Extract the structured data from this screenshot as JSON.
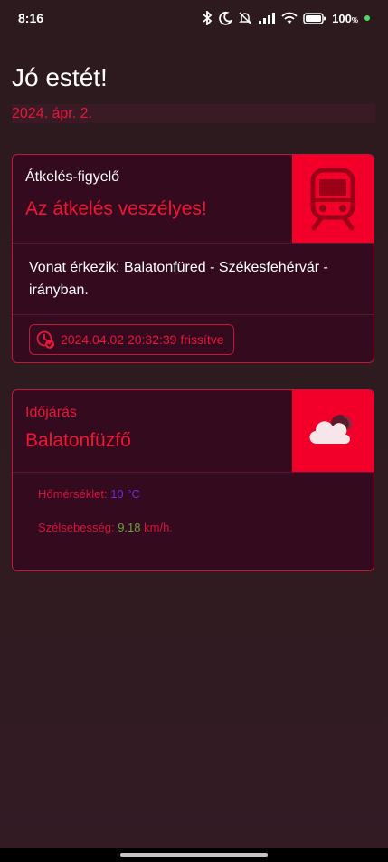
{
  "status_bar": {
    "time": "8:16",
    "battery": "100",
    "icons": [
      "bluetooth-icon",
      "moon-icon",
      "bell-muted-icon",
      "signal-icon",
      "wifi-icon",
      "battery-icon"
    ]
  },
  "header": {
    "greeting": "Jó estét!",
    "date": "2024. ápr. 2."
  },
  "crossing_card": {
    "subtitle": "Átkelés-figyelő",
    "status": "Az átkelés veszélyes!",
    "message": "Vonat érkezik: Balatonfüred - Székesfehérvár - irányban.",
    "updated": "2024.04.02 20:32:39 frissítve",
    "icon": "train-icon"
  },
  "weather_card": {
    "subtitle": "Időjárás",
    "location": "Balatonfüzfő",
    "icon": "cloudy-night-icon",
    "temperature_label": "Hőmérséklet:",
    "temperature_value": "10 °C",
    "wind_label": "Szélsebesség:",
    "wind_value": "9.18",
    "wind_unit": "km/h."
  },
  "colors": {
    "accent": "#f2002a",
    "card_bg": "#330a1e",
    "background": "#2f1b20",
    "temperature": "#6c2cd8",
    "wind": "#6aa23a"
  }
}
